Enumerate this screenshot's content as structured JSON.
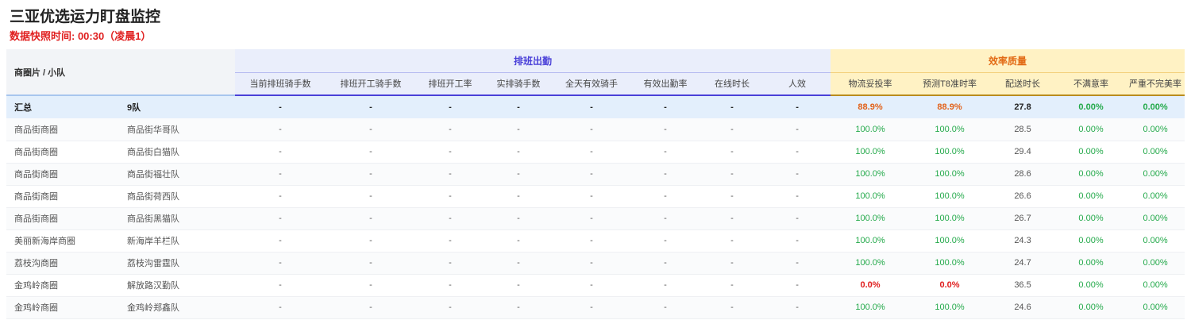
{
  "page": {
    "title": "三亚优选运力盯盘监控",
    "snapshot": "数据快照时间: 00:30（凌晨1）"
  },
  "table": {
    "left_header": "商圈片 / 小队",
    "groups": [
      {
        "label": "排班出勤",
        "columns": [
          "当前排班骑手数",
          "排班开工骑手数",
          "排班开工率",
          "实排骑手数",
          "全天有效骑手",
          "有效出勤率",
          "在线时长",
          "人效"
        ]
      },
      {
        "label": "效率质量",
        "columns": [
          "物流妥投率",
          "预测T8准时率",
          "配送时长",
          "不满意率",
          "严重不完美率"
        ]
      }
    ],
    "summary": {
      "area": "汇总",
      "team": "9队",
      "sched": [
        "-",
        "-",
        "-",
        "-",
        "-",
        "-",
        "-",
        "-"
      ],
      "eff": [
        "88.9%",
        "88.9%",
        "27.8",
        "0.00%",
        "0.00%"
      ]
    },
    "rows": [
      {
        "area": "商品街商圈",
        "team": "商品街华哥队",
        "sched": [
          "-",
          "-",
          "-",
          "-",
          "-",
          "-",
          "-",
          "-"
        ],
        "eff": [
          "100.0%",
          "100.0%",
          "28.5",
          "0.00%",
          "0.00%"
        ]
      },
      {
        "area": "商品街商圈",
        "team": "商品街白猫队",
        "sched": [
          "-",
          "-",
          "-",
          "-",
          "-",
          "-",
          "-",
          "-"
        ],
        "eff": [
          "100.0%",
          "100.0%",
          "29.4",
          "0.00%",
          "0.00%"
        ]
      },
      {
        "area": "商品街商圈",
        "team": "商品街福壮队",
        "sched": [
          "-",
          "-",
          "-",
          "-",
          "-",
          "-",
          "-",
          "-"
        ],
        "eff": [
          "100.0%",
          "100.0%",
          "28.6",
          "0.00%",
          "0.00%"
        ]
      },
      {
        "area": "商品街商圈",
        "team": "商品街荷西队",
        "sched": [
          "-",
          "-",
          "-",
          "-",
          "-",
          "-",
          "-",
          "-"
        ],
        "eff": [
          "100.0%",
          "100.0%",
          "26.6",
          "0.00%",
          "0.00%"
        ]
      },
      {
        "area": "商品街商圈",
        "team": "商品街黑猫队",
        "sched": [
          "-",
          "-",
          "-",
          "-",
          "-",
          "-",
          "-",
          "-"
        ],
        "eff": [
          "100.0%",
          "100.0%",
          "26.7",
          "0.00%",
          "0.00%"
        ]
      },
      {
        "area": "美丽新海岸商圈",
        "team": "新海岸羊栏队",
        "sched": [
          "-",
          "-",
          "-",
          "-",
          "-",
          "-",
          "-",
          "-"
        ],
        "eff": [
          "100.0%",
          "100.0%",
          "24.3",
          "0.00%",
          "0.00%"
        ]
      },
      {
        "area": "荔枝沟商圈",
        "team": "荔枝沟雷霆队",
        "sched": [
          "-",
          "-",
          "-",
          "-",
          "-",
          "-",
          "-",
          "-"
        ],
        "eff": [
          "100.0%",
          "100.0%",
          "24.7",
          "0.00%",
          "0.00%"
        ]
      },
      {
        "area": "金鸡岭商圈",
        "team": "解放路汉勤队",
        "sched": [
          "-",
          "-",
          "-",
          "-",
          "-",
          "-",
          "-",
          "-"
        ],
        "eff": [
          "0.0%",
          "0.0%",
          "36.5",
          "0.00%",
          "0.00%"
        ]
      },
      {
        "area": "金鸡岭商圈",
        "team": "金鸡岭郑鑫队",
        "sched": [
          "-",
          "-",
          "-",
          "-",
          "-",
          "-",
          "-",
          "-"
        ],
        "eff": [
          "100.0%",
          "100.0%",
          "24.6",
          "0.00%",
          "0.00%"
        ]
      }
    ]
  },
  "colors": {
    "good": "#23a94a",
    "warn": "#e2621a",
    "bad": "#e02020",
    "header_blue": "#4a40d8",
    "header_orange": "#e26a14"
  }
}
